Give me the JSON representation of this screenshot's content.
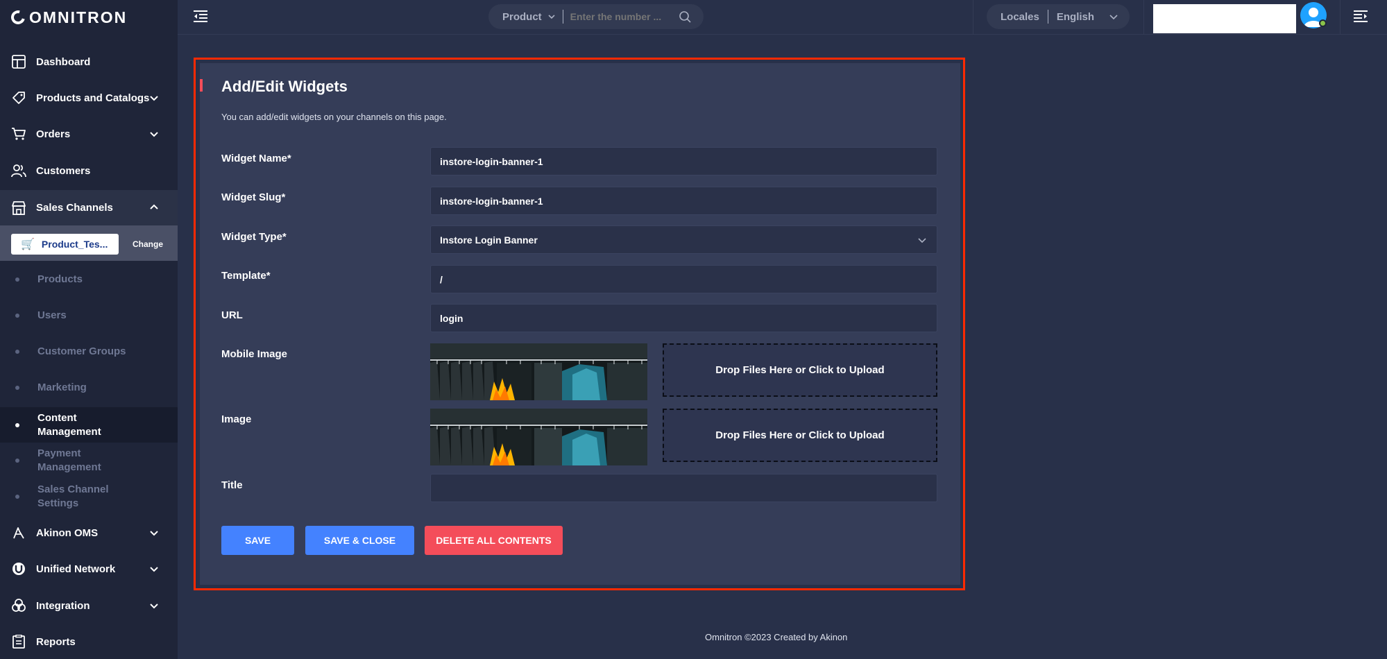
{
  "app": {
    "logo_text": "OMNITRON"
  },
  "sidebar": {
    "items": [
      {
        "label": "Dashboard",
        "icon": "dashboard-icon"
      },
      {
        "label": "Products and Catalogs",
        "icon": "tag-icon"
      },
      {
        "label": "Orders",
        "icon": "cart-icon"
      },
      {
        "label": "Customers",
        "icon": "users-icon"
      },
      {
        "label": "Sales Channels",
        "icon": "store-icon"
      },
      {
        "label": "Akinon OMS",
        "icon": "oms-icon"
      },
      {
        "label": "Unified Network",
        "icon": "network-icon"
      },
      {
        "label": "Integration",
        "icon": "integration-icon"
      },
      {
        "label": "Reports",
        "icon": "reports-icon"
      }
    ],
    "channel": {
      "name": "Product_Tes...",
      "change_label": "Change"
    },
    "sub_items": [
      {
        "label": "Products"
      },
      {
        "label": "Users"
      },
      {
        "label": "Customer Groups"
      },
      {
        "label": "Marketing"
      },
      {
        "label": "Content Management"
      },
      {
        "label": "Payment Management"
      },
      {
        "label": "Sales Channel Settings"
      }
    ]
  },
  "topbar": {
    "search_type": "Product",
    "search_placeholder": "Enter the number ...",
    "locale_label": "Locales",
    "locale_value": "English"
  },
  "form": {
    "title": "Add/Edit Widgets",
    "description": "You can add/edit widgets on your channels on this page.",
    "widget_name_label": "Widget Name",
    "widget_name_value": "instore-login-banner-1",
    "widget_slug_label": "Widget Slug",
    "widget_slug_value": "instore-login-banner-1",
    "widget_type_label": "Widget Type",
    "widget_type_value": "Instore Login Banner",
    "template_label": "Template",
    "template_value": "/",
    "url_label": "URL",
    "url_value": "login",
    "mobile_image_label": "Mobile Image",
    "image_label": "Image",
    "dropzone_text": "Drop Files Here or Click to Upload",
    "title_label": "Title",
    "title_value": "",
    "required_mark": "*"
  },
  "actions": {
    "save": "SAVE",
    "save_close": "SAVE & CLOSE",
    "delete_all": "DELETE ALL CONTENTS"
  },
  "footer": {
    "text": "Omnitron ©2023 Created by Akinon"
  },
  "colors": {
    "accent_blue": "#4482ff",
    "danger_red": "#f44d5a",
    "highlight_outline": "#ff2a00"
  }
}
